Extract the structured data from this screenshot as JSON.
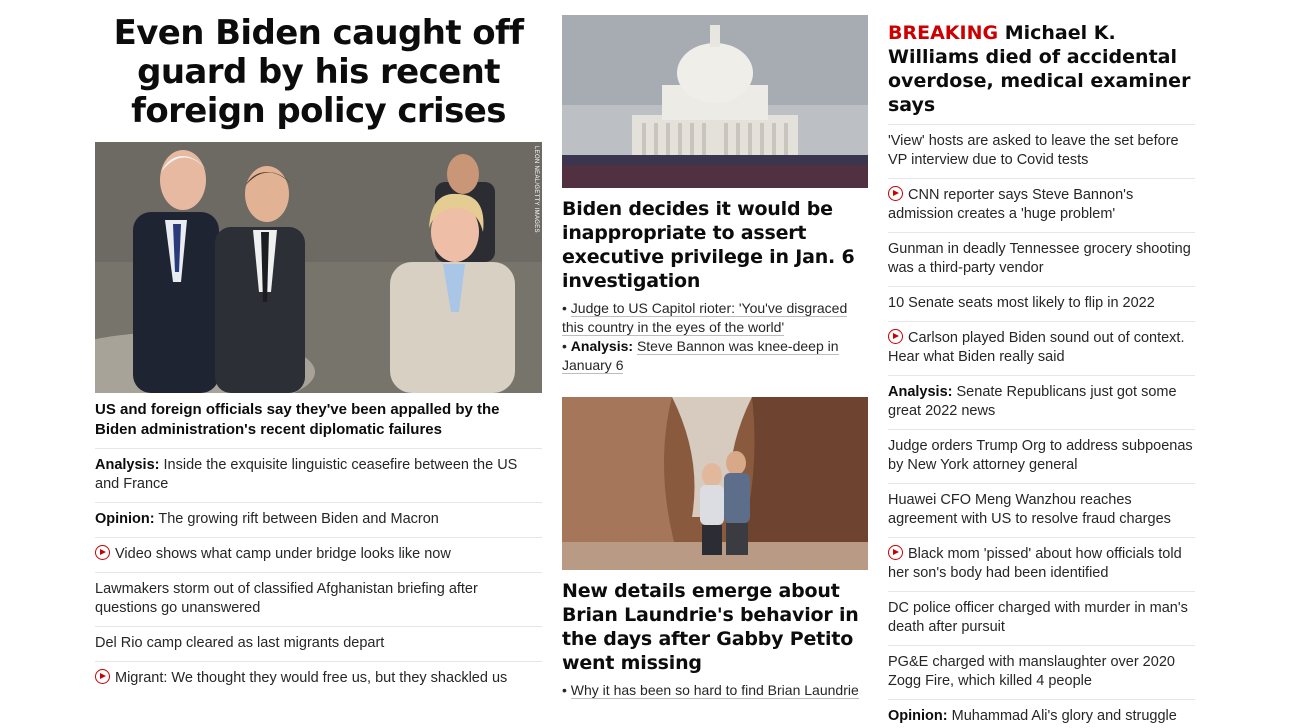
{
  "col1": {
    "headline": "Even Biden caught off guard by his recent foreign policy crises",
    "image_credit": "LEON NEAL/GETTY IMAGES",
    "sub_headline": "US and foreign officials say they've been appalled by the Biden administration's recent diplomatic failures",
    "items": [
      {
        "prefix": "Analysis:",
        "text": "Inside the exquisite linguistic ceasefire between the US and France",
        "video": false
      },
      {
        "prefix": "Opinion:",
        "text": "The growing rift between Biden and Macron",
        "video": false
      },
      {
        "prefix": "",
        "text": "Video shows what camp under bridge looks like now",
        "video": true
      },
      {
        "prefix": "",
        "text": "Lawmakers storm out of classified Afghanistan briefing after questions go unanswered",
        "video": false
      },
      {
        "prefix": "",
        "text": "Del Rio camp cleared as last migrants depart",
        "video": false
      },
      {
        "prefix": "",
        "text": "Migrant: We thought they would free us, but they shackled us",
        "video": true
      }
    ]
  },
  "col2": {
    "card1": {
      "headline": "Biden decides it would be inappropriate to assert executive privilege in Jan. 6 investigation",
      "bullets": [
        {
          "prefix": "",
          "text": "Judge to US Capitol rioter: 'You've disgraced this country in the eyes of the world'"
        },
        {
          "prefix": "Analysis:",
          "text": "Steve Bannon was knee-deep in January 6"
        }
      ]
    },
    "card2": {
      "headline": "New details emerge about Brian Laundrie's behavior in the days after Gabby Petito went missing",
      "bullets": [
        {
          "prefix": "",
          "text": "Why it has been so hard to find Brian Laundrie"
        }
      ]
    }
  },
  "col3": {
    "breaking_tag": "BREAKING",
    "breaking_headline": "Michael K. Williams died of accidental overdose, medical examiner says",
    "items": [
      {
        "prefix": "",
        "text": "'View' hosts are asked to leave the set before VP interview due to Covid tests",
        "video": false
      },
      {
        "prefix": "",
        "text": "CNN reporter says Steve Bannon's admission creates a 'huge problem'",
        "video": true
      },
      {
        "prefix": "",
        "text": "Gunman in deadly Tennessee grocery shooting was a third-party vendor",
        "video": false
      },
      {
        "prefix": "",
        "text": "10 Senate seats most likely to flip in 2022",
        "video": false
      },
      {
        "prefix": "",
        "text": "Carlson played Biden sound out of context. Hear what Biden really said",
        "video": true
      },
      {
        "prefix": "Analysis:",
        "text": "Senate Republicans just got some great 2022 news",
        "video": false
      },
      {
        "prefix": "",
        "text": "Judge orders Trump Org to address subpoenas by New York attorney general",
        "video": false
      },
      {
        "prefix": "",
        "text": "Huawei CFO Meng Wanzhou reaches agreement with US to resolve fraud charges",
        "video": false
      },
      {
        "prefix": "",
        "text": "Black mom 'pissed' about how officials told her son's body had been identified",
        "video": true
      },
      {
        "prefix": "",
        "text": "DC police officer charged with murder in man's death after pursuit",
        "video": false
      },
      {
        "prefix": "",
        "text": "PG&E charged with manslaughter over 2020 Zogg Fire, which killed 4 people",
        "video": false
      },
      {
        "prefix": "Opinion:",
        "text": "Muhammad Ali's glory and struggle",
        "video": false
      }
    ]
  },
  "colors": {
    "breaking": "#cc0000",
    "divider": "#e6e6e6",
    "text": "#0c0c0c"
  }
}
